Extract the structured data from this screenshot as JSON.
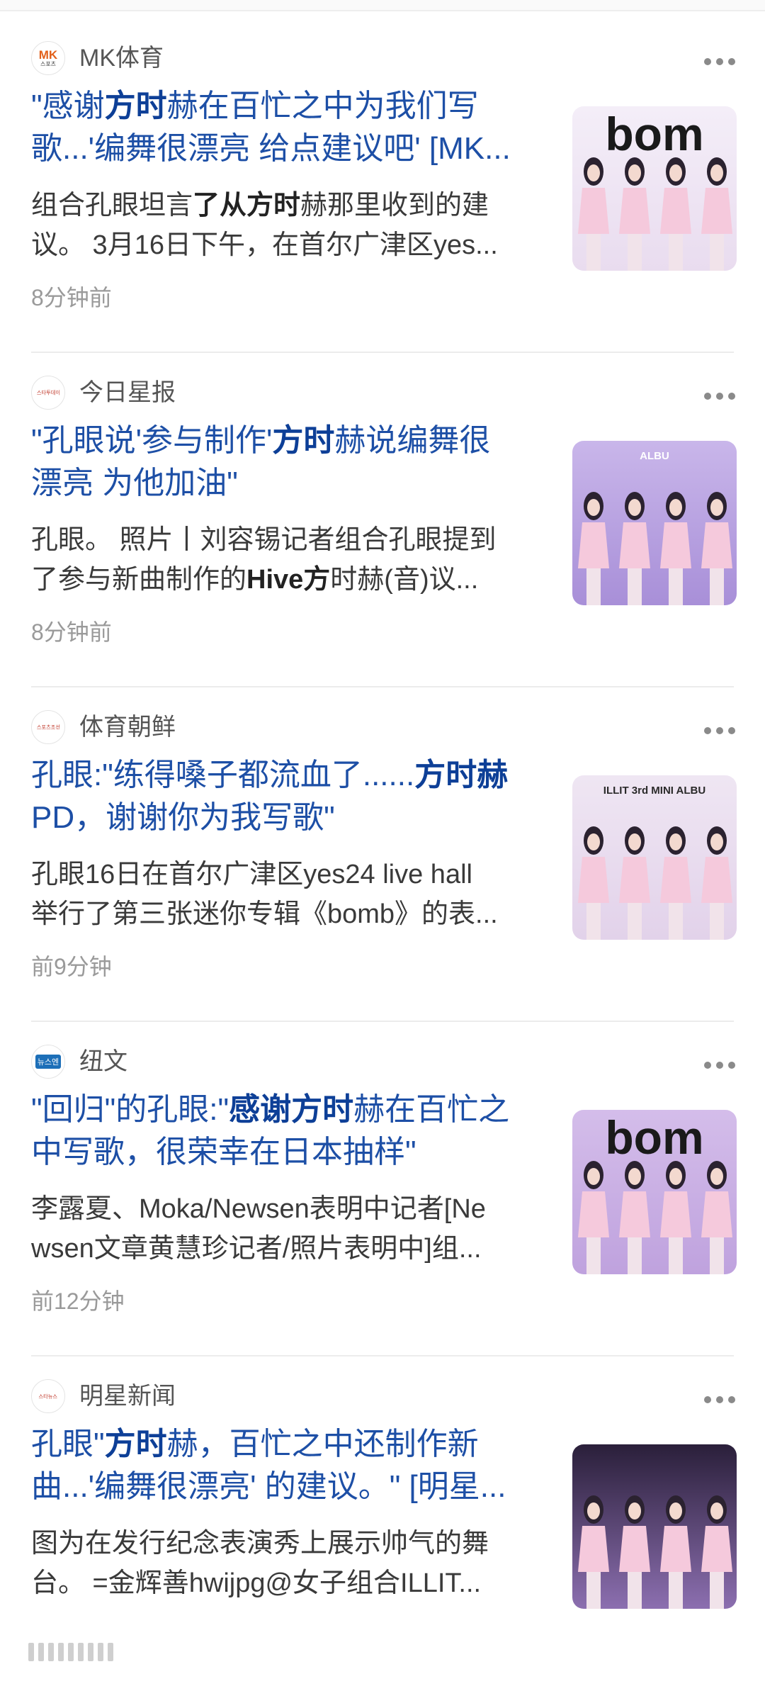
{
  "articles": [
    {
      "source": "MK体育",
      "logo_text": "MK",
      "logo_sub": "스포츠",
      "title_lines": [
        [
          {
            "t": "\"感谢",
            "b": false
          },
          {
            "t": "方时",
            "b": true
          },
          {
            "t": "赫在百忙之中为我们写",
            "b": false
          }
        ],
        [
          {
            "t": "歌...'编舞很漂亮 给点建议吧' [MK...",
            "b": false
          }
        ]
      ],
      "snippet_lines": [
        [
          {
            "t": "组合孔眼坦言",
            "b": false
          },
          {
            "t": "了从方时",
            "b": true
          },
          {
            "t": "赫那里收到的建",
            "b": false
          }
        ],
        [
          {
            "t": "议。 3月16日下午，在首尔广津区yes...",
            "b": false
          }
        ]
      ],
      "time": "8分钟前",
      "thumb": {
        "bg_top": "#f4eef8",
        "bg_bottom": "#e9dcef",
        "text": "bom",
        "text_color": "#1a1a1a"
      }
    },
    {
      "source": "今日星报",
      "logo_text": "스타투데이",
      "logo_sub": "",
      "title_lines": [
        [
          {
            "t": "\"孔眼说'参与制作'",
            "b": false
          },
          {
            "t": "方时",
            "b": true
          },
          {
            "t": "赫说编舞很",
            "b": false
          }
        ],
        [
          {
            "t": "漂亮 为他加油\"",
            "b": false
          }
        ]
      ],
      "snippet_lines": [
        [
          {
            "t": "孔眼。 照片丨刘容锡记者组合孔眼提到",
            "b": false
          }
        ],
        [
          {
            "t": "了参与新曲制作的",
            "b": false
          },
          {
            "t": "Hive方",
            "b": true
          },
          {
            "t": "时赫(音)议...",
            "b": false
          }
        ]
      ],
      "time": "8分钟前",
      "thumb": {
        "bg_top": "#c9b6ea",
        "bg_bottom": "#a88fd8",
        "text": "ALBU",
        "text_color": "#ffffff"
      }
    },
    {
      "source": "体育朝鲜",
      "logo_text": "스포츠조선",
      "logo_sub": "",
      "title_lines": [
        [
          {
            "t": "孔眼:\"练得嗓子都流血了......",
            "b": false
          },
          {
            "t": "方时赫",
            "b": true
          }
        ],
        [
          {
            "t": "PD，谢谢你为我写歌\"",
            "b": false
          }
        ]
      ],
      "snippet_lines": [
        [
          {
            "t": "孔眼16日在首尔广津区yes24 live hall",
            "b": false
          }
        ],
        [
          {
            "t": "举行了第三张迷你专辑《bomb》的表...",
            "b": false
          }
        ]
      ],
      "time": "前9分钟",
      "thumb": {
        "bg_top": "#efe6f3",
        "bg_bottom": "#e2d2ea",
        "text": "ILLIT 3rd MINI ALBU",
        "text_color": "#2a2a2a"
      }
    },
    {
      "source": "纽文",
      "logo_text": "뉴스엔",
      "logo_sub": "",
      "title_lines": [
        [
          {
            "t": "\"回归\"的孔眼:\"",
            "b": false
          },
          {
            "t": "感谢方时",
            "b": true
          },
          {
            "t": "赫在百忙之",
            "b": false
          }
        ],
        [
          {
            "t": "中写歌，很荣幸在日本抽样\"",
            "b": false
          }
        ]
      ],
      "snippet_lines": [
        [
          {
            "t": "李露夏、Moka/Newsen表明中记者[Ne",
            "b": false
          }
        ],
        [
          {
            "t": "wsen文章黄慧珍记者/照片表明中]组...",
            "b": false
          }
        ]
      ],
      "time": "前12分钟",
      "thumb": {
        "bg_top": "#d4bdea",
        "bg_bottom": "#bfa2de",
        "text": "bom",
        "text_color": "#1a1a1a"
      }
    },
    {
      "source": "明星新闻",
      "logo_text": "스타뉴스",
      "logo_sub": "",
      "title_lines": [
        [
          {
            "t": "孔眼\"",
            "b": false
          },
          {
            "t": "方时",
            "b": true
          },
          {
            "t": "赫，百忙之中还制作新",
            "b": false
          }
        ],
        [
          {
            "t": "曲...'编舞很漂亮' 的建议。\" [明星...",
            "b": false
          }
        ]
      ],
      "snippet_lines": [
        [
          {
            "t": "图为在发行纪念表演秀上展示帅气的舞",
            "b": false
          }
        ],
        [
          {
            "t": "台。 =金辉善hwijpg@女子组合ILLIT...",
            "b": false
          }
        ]
      ],
      "time": "",
      "thumb": {
        "bg_top": "#2a1f3a",
        "bg_bottom": "#8c6fb0",
        "text": "",
        "text_color": "#ffffff"
      }
    }
  ]
}
